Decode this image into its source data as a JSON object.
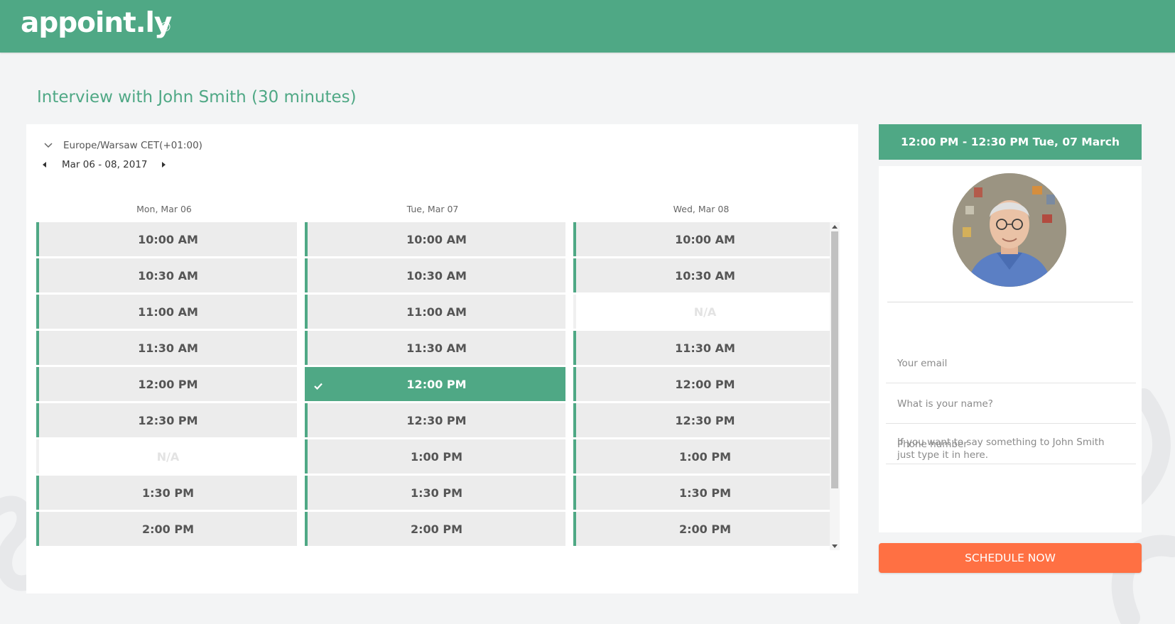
{
  "app": {
    "logo": "appoint.ly",
    "logo_mark": "©"
  },
  "page": {
    "title": "Interview with John Smith (30 minutes)"
  },
  "calendar": {
    "timezone": "Europe/Warsaw CET(+01:00)",
    "date_range": "Mar 06 - 08, 2017",
    "days": [
      {
        "label": "Mon, Mar 06",
        "slots": [
          "10:00 AM",
          "10:30 AM",
          "11:00 AM",
          "11:30 AM",
          "12:00 PM",
          "12:30 PM",
          "N/A",
          "1:30 PM",
          "2:00 PM"
        ]
      },
      {
        "label": "Tue, Mar 07",
        "slots": [
          "10:00 AM",
          "10:30 AM",
          "11:00 AM",
          "11:30 AM",
          "12:00 PM",
          "12:30 PM",
          "1:00 PM",
          "1:30 PM",
          "2:00 PM"
        ]
      },
      {
        "label": "Wed, Mar 08",
        "slots": [
          "10:00 AM",
          "10:30 AM",
          "N/A",
          "11:30 AM",
          "12:00 PM",
          "12:30 PM",
          "1:00 PM",
          "1:30 PM",
          "2:00 PM"
        ]
      }
    ],
    "selected": {
      "day": 1,
      "slot": 4
    }
  },
  "booking": {
    "summary": "12:00 PM - 12:30 PM Tue, 07 March",
    "email_placeholder": "Your email",
    "name_placeholder": "What is your name?",
    "phone_placeholder": "Phone number",
    "message_placeholder": "If you want to say something to John Smith just type it in here.",
    "submit_label": "SCHEDULE NOW"
  },
  "colors": {
    "brand": "#4fa885",
    "cta": "#ff7043",
    "background": "#f3f4f5"
  },
  "icons": {
    "timezone_toggle": "chevron-down-icon",
    "prev": "caret-left-icon",
    "next": "caret-right-icon",
    "selected_slot": "check-icon"
  }
}
